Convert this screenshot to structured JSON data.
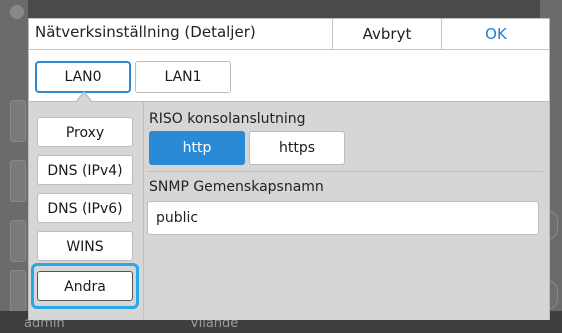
{
  "dialog": {
    "title": "Nätverksinställning (Detaljer)",
    "cancel_label": "Avbryt",
    "ok_label": "OK"
  },
  "tabs": [
    {
      "label": "LAN0",
      "selected": true
    },
    {
      "label": "LAN1",
      "selected": false
    }
  ],
  "sidebar": {
    "items": [
      {
        "label": "Proxy"
      },
      {
        "label": "DNS (IPv4)"
      },
      {
        "label": "DNS (IPv6)"
      },
      {
        "label": "WINS"
      },
      {
        "label": "Andra",
        "selected": true
      }
    ]
  },
  "riso": {
    "label": "RISO konsolanslutning",
    "options": [
      "http",
      "https"
    ],
    "selected": "http"
  },
  "snmp": {
    "label": "SNMP Gemenskapsnamn",
    "value": "public"
  },
  "background": {
    "bottom_left": "admin",
    "bottom_mid": "Vilande"
  },
  "colors": {
    "accent": "#2a8ad6",
    "focus_ring": "#29a8e6",
    "ok_text": "#1c7fd6"
  }
}
